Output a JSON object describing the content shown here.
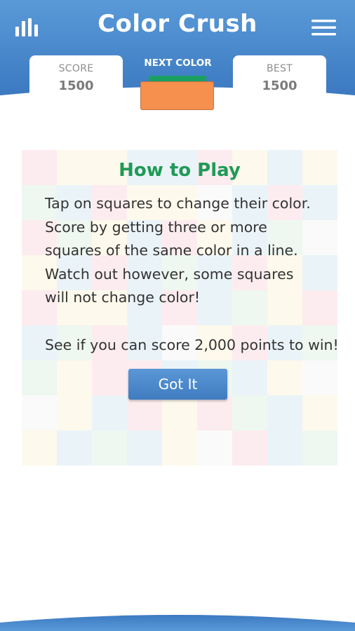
{
  "app": {
    "title": "Color Crush"
  },
  "header": {
    "stats_icon": "bar-chart-icon",
    "menu_icon": "hamburger-menu-icon",
    "score_label": "SCORE",
    "score_value": "1500",
    "next_label": "NEXT COLOR",
    "best_label": "BEST",
    "best_value": "1500"
  },
  "next_color": {
    "front": "#f5904f",
    "back": "#1aa063"
  },
  "how_to_play": {
    "title": "How to Play",
    "body": "Tap on squares to change their color. Score by getting three or more squares of the same color in a line. Watch out however, some squares will not change color!",
    "goal": "See if you can score 2,000 points to win!",
    "button_label": "Got It"
  },
  "colors": {
    "header_blue": "#4e8fd1",
    "header_blue_dark": "#3b78c0",
    "title_green": "#1f9a57",
    "button_blue": "#4a88cb"
  },
  "board": {
    "size": 9,
    "palette": {
      "r": "#fdecef",
      "b": "#eaf4f8",
      "y": "#fdf9ec",
      "g": "#eef7f0",
      "w": "#fafafa"
    },
    "rows": [
      "ryybbryby",
      "gbryywbrb",
      "rgybrybgw",
      "ybrbgbryb",
      "ryybrbgyr",
      "bgrbwyrbg",
      "gyrrbgbyw",
      "wybryrgby",
      "ybgbywrbg"
    ]
  }
}
